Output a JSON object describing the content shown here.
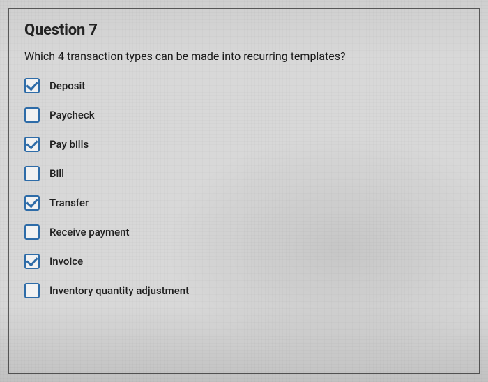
{
  "question": {
    "title": "Question 7",
    "prompt": "Which 4 transaction types can be made into recurring templates?",
    "options": [
      {
        "label": "Deposit",
        "checked": true
      },
      {
        "label": "Paycheck",
        "checked": false
      },
      {
        "label": "Pay bills",
        "checked": true
      },
      {
        "label": "Bill",
        "checked": false
      },
      {
        "label": "Transfer",
        "checked": true
      },
      {
        "label": "Receive payment",
        "checked": false
      },
      {
        "label": "Invoice",
        "checked": true
      },
      {
        "label": "Inventory quantity adjustment",
        "checked": false
      }
    ]
  }
}
